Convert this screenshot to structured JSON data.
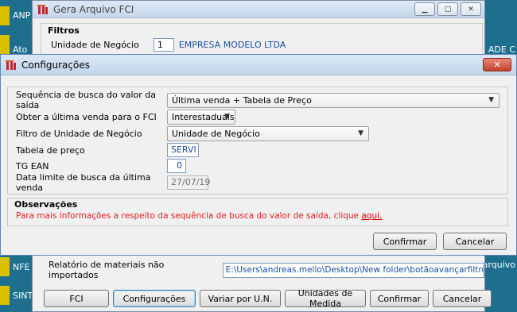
{
  "desktop": {
    "left_labels": [
      "ANP",
      "Ato",
      "NFE",
      "SINT"
    ],
    "right_labels": [
      "ADE C",
      "a arquivo"
    ]
  },
  "back_window": {
    "title": "Gera Arquivo FCI",
    "controls": [
      "minimize",
      "maximize",
      "close"
    ],
    "filtros": {
      "title": "Filtros",
      "unidade_label": "Unidade de Negócio",
      "unidade_code": "1",
      "unidade_name": "EMPRESA MODELO LTDA"
    },
    "relatorio": {
      "label": "Relatório de materiais não importados",
      "path": "E:\\Users\\andreas.mello\\Desktop\\New folder\\botãoavançarfiltrodeman"
    },
    "buttons": [
      "FCI",
      "Configurações",
      "Variar por U.N.",
      "Unidades de Medida",
      "Confirmar",
      "Cancelar"
    ]
  },
  "dialog": {
    "title": "Configurações",
    "close_glyph": "✕",
    "fields": {
      "sequencia": {
        "label": "Sequência de busca do valor da saída",
        "value": "Última venda + Tabela de Preço"
      },
      "ultima_venda": {
        "label": "Obter a última venda para o FCI",
        "value": "Interestaduais"
      },
      "filtro_un": {
        "label": "Filtro de Unidade de Negócio",
        "value": "Unidade de Negócio"
      },
      "tabela_preco": {
        "label": "Tabela de preço",
        "value": "SERVI"
      },
      "tg_ean": {
        "label": "TG EAN",
        "value": "0"
      },
      "data_limite": {
        "label": "Data limite de busca da última venda",
        "value": "27/07/19"
      }
    },
    "observacoes": {
      "title": "Observações",
      "text": "Para mais informações a respeito da sequência de busca do valor de saída, clique",
      "link": "aqui."
    },
    "buttons": {
      "confirm": "Confirmar",
      "cancel": "Cancelar"
    }
  },
  "colors": {
    "desktop_bg": "#1e6e8e",
    "accent_tile": "#d8c000",
    "link_red": "#e02020",
    "field_blue": "#1a4fa0"
  }
}
